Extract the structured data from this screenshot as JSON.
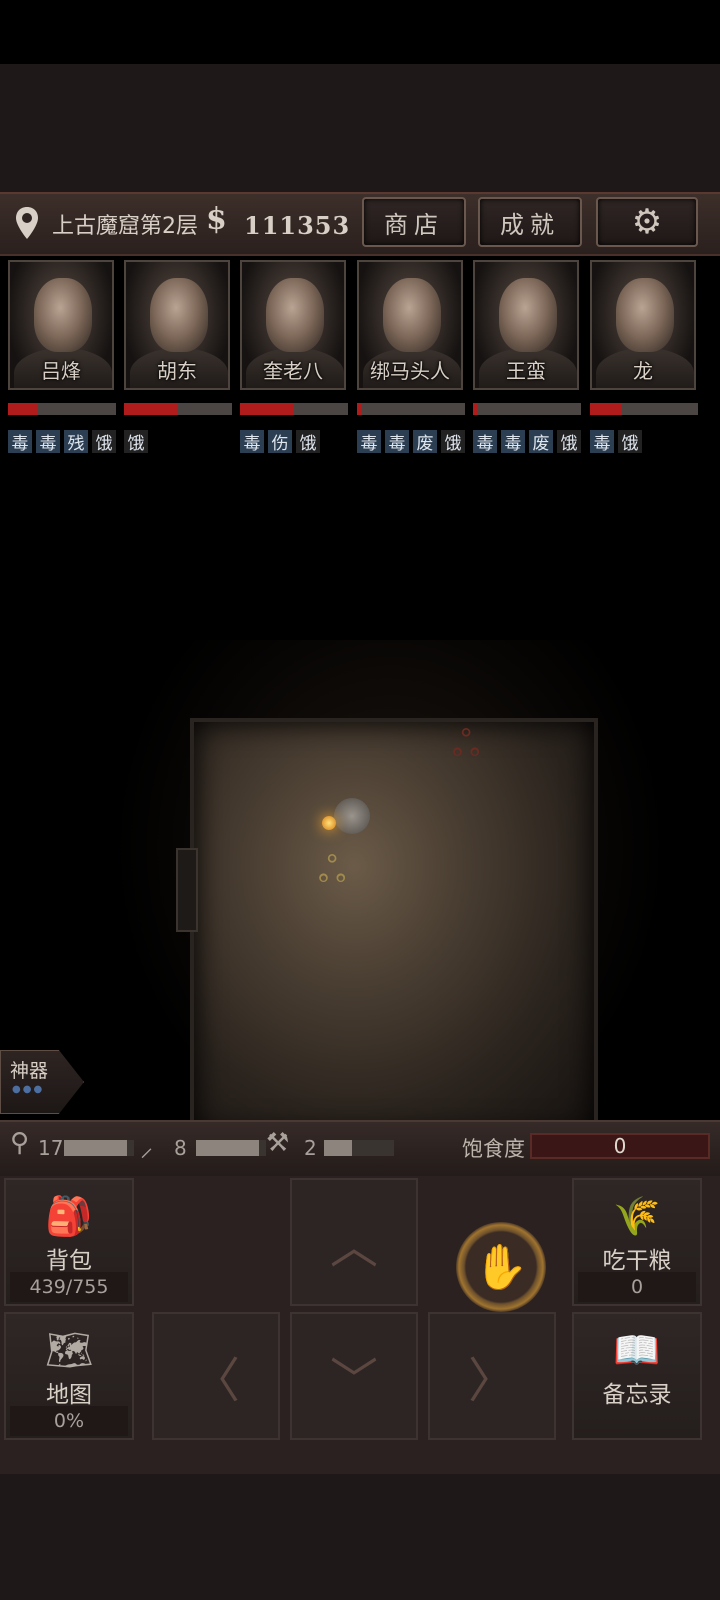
{
  "header": {
    "location": "上古魔窟第2层",
    "currency_symbol": "$",
    "money": "111353",
    "shop_label": "商店",
    "achievement_label": "成就",
    "settings_icon": "gear-icon"
  },
  "party": [
    {
      "name": "吕烽",
      "hp_fraction": 0.28,
      "tags": [
        "毒",
        "毒",
        "残",
        "饿"
      ]
    },
    {
      "name": "胡东",
      "hp_fraction": 0.5,
      "tags": [
        "饿"
      ]
    },
    {
      "name": "奎老八",
      "hp_fraction": 0.5,
      "tags": [
        "毒",
        "伤",
        "饿"
      ]
    },
    {
      "name": "绑马头人",
      "hp_fraction": 0.05,
      "tags": [
        "毒",
        "毒",
        "废",
        "饿"
      ]
    },
    {
      "name": "王蛮",
      "hp_fraction": 0.05,
      "tags": [
        "毒",
        "毒",
        "废",
        "饿"
      ]
    },
    {
      "name": "龙",
      "hp_fraction": 0.3,
      "tags": [
        "毒",
        "饿"
      ]
    }
  ],
  "artifact": {
    "label": "神器",
    "dots": "●●●"
  },
  "tools": [
    {
      "icon": "torch-icon",
      "count": "17",
      "fraction": 0.9
    },
    {
      "icon": "pickaxe-icon",
      "count": "8",
      "fraction": 0.9
    },
    {
      "icon": "shovel-icon",
      "count": "2",
      "fraction": 0.4
    }
  ],
  "satiety": {
    "label": "饱食度",
    "value": "0"
  },
  "controls": {
    "backpack": {
      "label": "背包",
      "sub": "439/755"
    },
    "eat": {
      "label": "吃干粮",
      "sub": "0"
    },
    "map": {
      "label": "地图",
      "sub": "0%"
    },
    "memo": {
      "label": "备忘录"
    },
    "up": "︿",
    "down": "﹀",
    "left": "〈",
    "right": "〉",
    "hand_icon": "✋"
  },
  "colors": {
    "hp": "#b01c1c",
    "tag_bg": "#2c3e52",
    "hand_accent": "#d88e36"
  }
}
